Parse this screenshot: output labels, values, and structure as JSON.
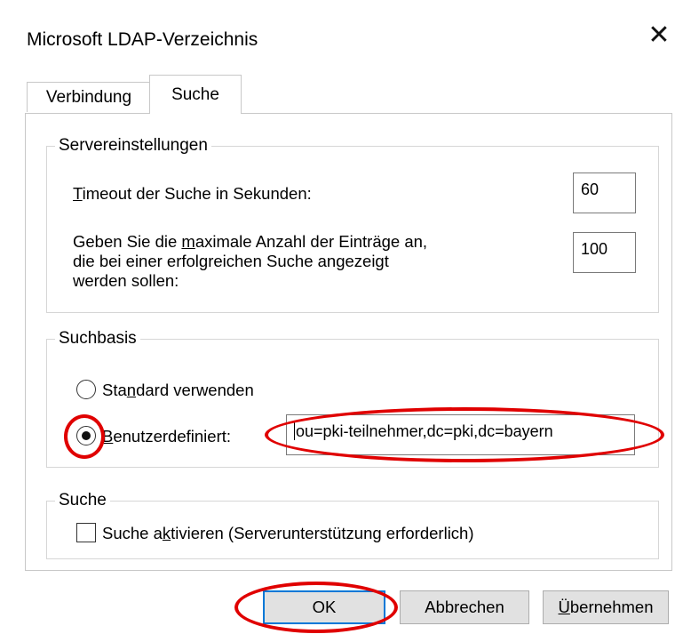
{
  "window": {
    "title": "Microsoft LDAP-Verzeichnis",
    "close_glyph": "✕"
  },
  "tabs": [
    {
      "label": "Verbindung",
      "active": false
    },
    {
      "label": "Suche",
      "active": true
    }
  ],
  "server_settings": {
    "legend": "Servereinstellungen",
    "timeout_label_pre": "",
    "timeout_label_mnemonic": "T",
    "timeout_label_post": "imeout der Suche in Sekunden:",
    "timeout_value": "60",
    "max_entries_line1_pre": "Geben Sie die ",
    "max_entries_line1_mnemonic": "m",
    "max_entries_line1_post": "aximale Anzahl der Einträge an,",
    "max_entries_line2": "die bei einer erfolgreichen Suche angezeigt",
    "max_entries_line3": "werden sollen:",
    "max_entries_value": "100"
  },
  "search_base": {
    "legend": "Suchbasis",
    "standard_pre": "Sta",
    "standard_mnemonic": "n",
    "standard_post": "dard verwenden",
    "custom_mnemonic": "B",
    "custom_post": "enutzerdefiniert:",
    "custom_value": "ou=pki-teilnehmer,dc=pki,dc=bayern",
    "selected": "custom"
  },
  "search": {
    "legend": "Suche",
    "checkbox_pre": "Suche a",
    "checkbox_mnemonic": "k",
    "checkbox_post": "tivieren (Serverunterstützung erforderlich)",
    "checked": false
  },
  "buttons": {
    "ok": "OK",
    "cancel": "Abbrechen",
    "apply_mnemonic": "Ü",
    "apply_post": "bernehmen"
  },
  "annotation_color": "#e00000",
  "focus_color": "#0078d7"
}
